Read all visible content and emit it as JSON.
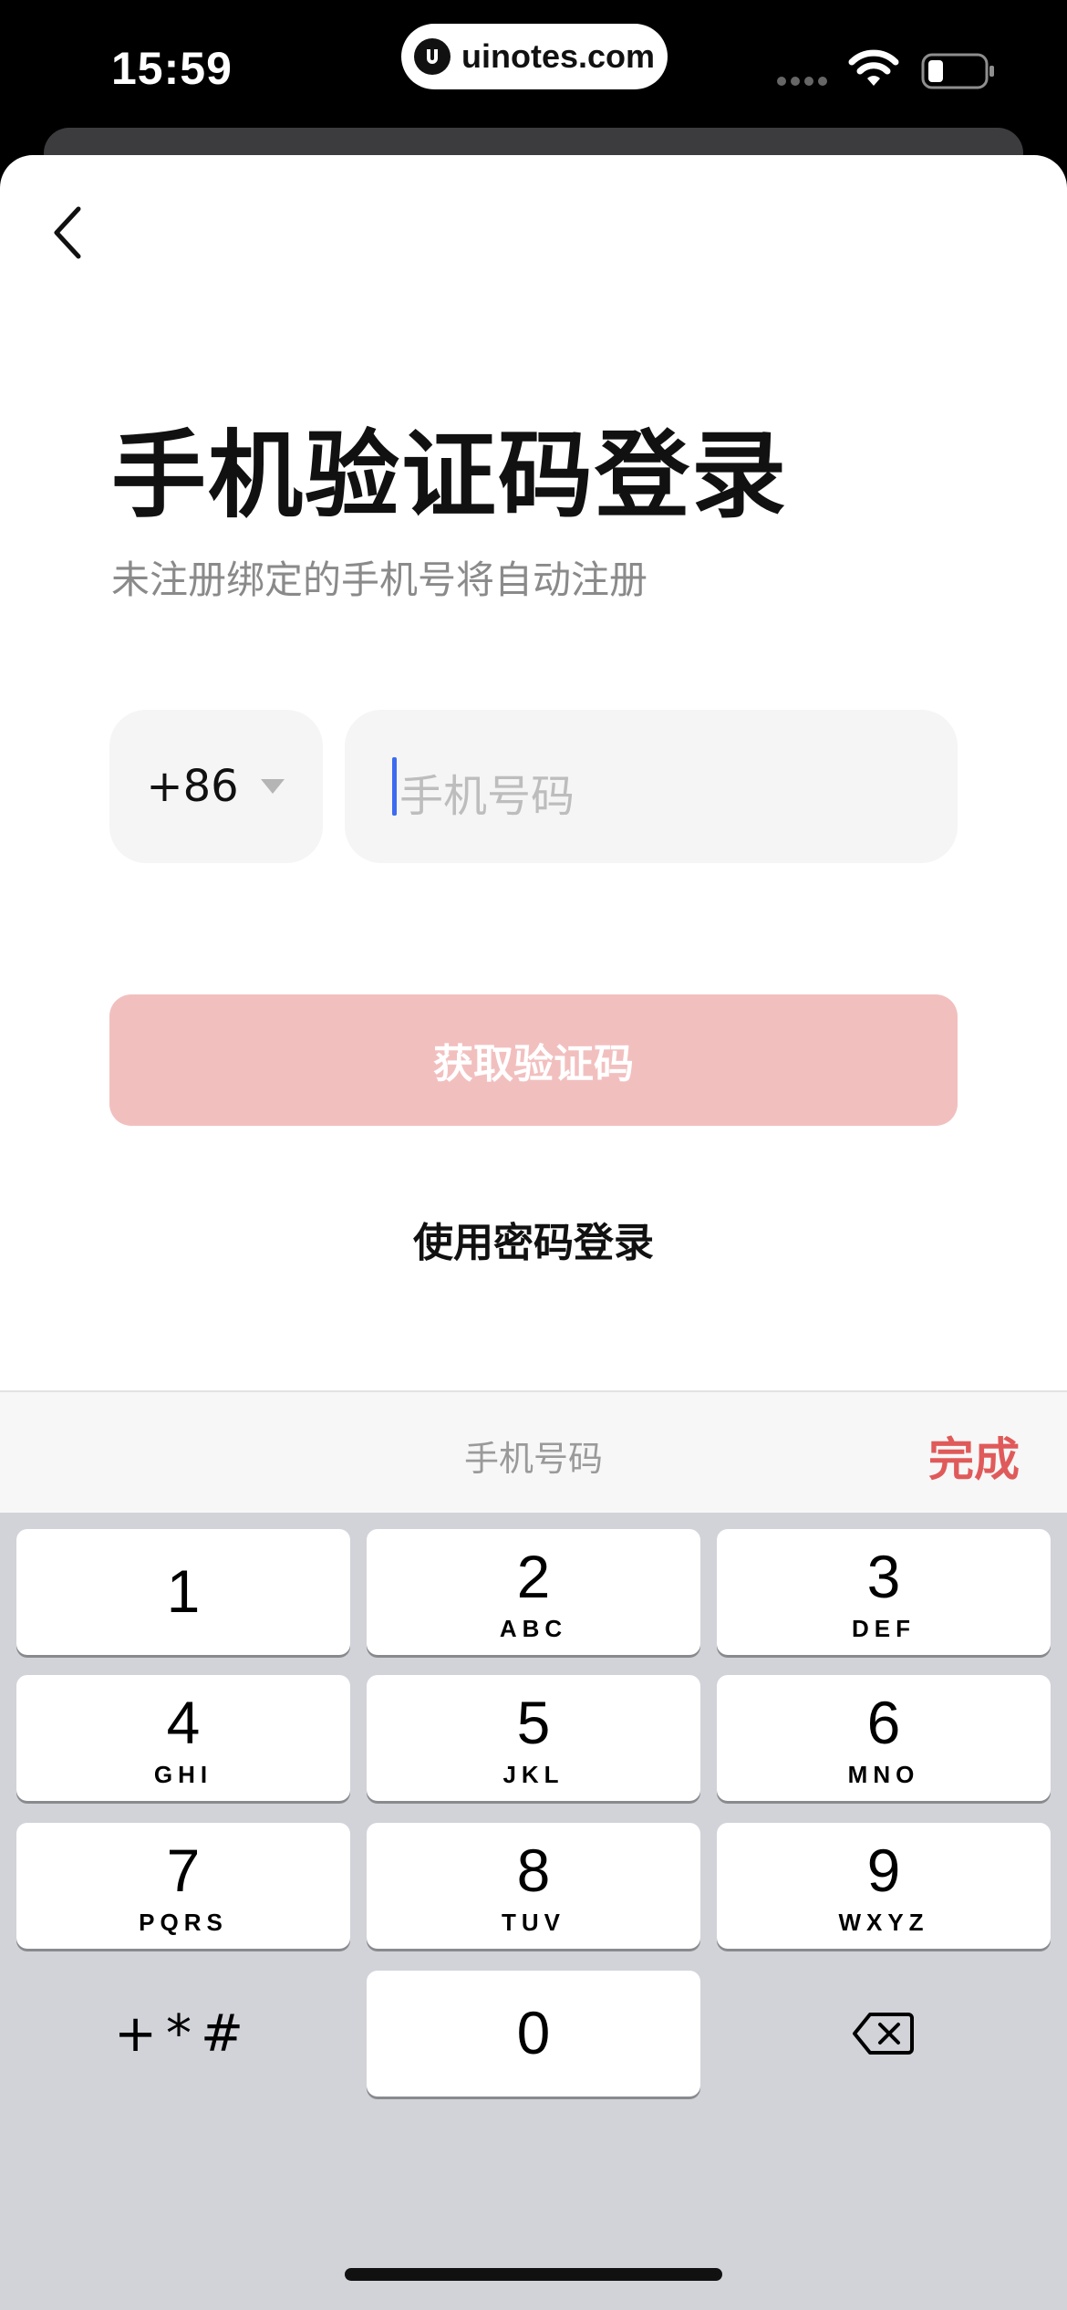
{
  "status_bar": {
    "time": "15:59",
    "url": "uinotes.com"
  },
  "header": {
    "title": "手机验证码登录",
    "subtitle": "未注册绑定的手机号将自动注册"
  },
  "form": {
    "country_code": "+86",
    "phone_placeholder": "手机号码",
    "get_code_label": "获取验证码",
    "password_login_label": "使用密码登录"
  },
  "keyboard": {
    "toolbar_label": "手机号码",
    "done_label": "完成",
    "accent_color": "#e05a5a",
    "keys": [
      {
        "digit": "1",
        "letters": ""
      },
      {
        "digit": "2",
        "letters": "ABC"
      },
      {
        "digit": "3",
        "letters": "DEF"
      },
      {
        "digit": "4",
        "letters": "GHI"
      },
      {
        "digit": "5",
        "letters": "JKL"
      },
      {
        "digit": "6",
        "letters": "MNO"
      },
      {
        "digit": "7",
        "letters": "PQRS"
      },
      {
        "digit": "8",
        "letters": "TUV"
      },
      {
        "digit": "9",
        "letters": "WXYZ"
      },
      {
        "digit": "0",
        "letters": ""
      }
    ],
    "symbols_label": "+*#"
  },
  "icons": {
    "back": "chevron-left-icon",
    "dropdown": "caret-down-icon",
    "delete": "backspace-icon",
    "wifi": "wifi-icon",
    "battery": "battery-icon"
  }
}
